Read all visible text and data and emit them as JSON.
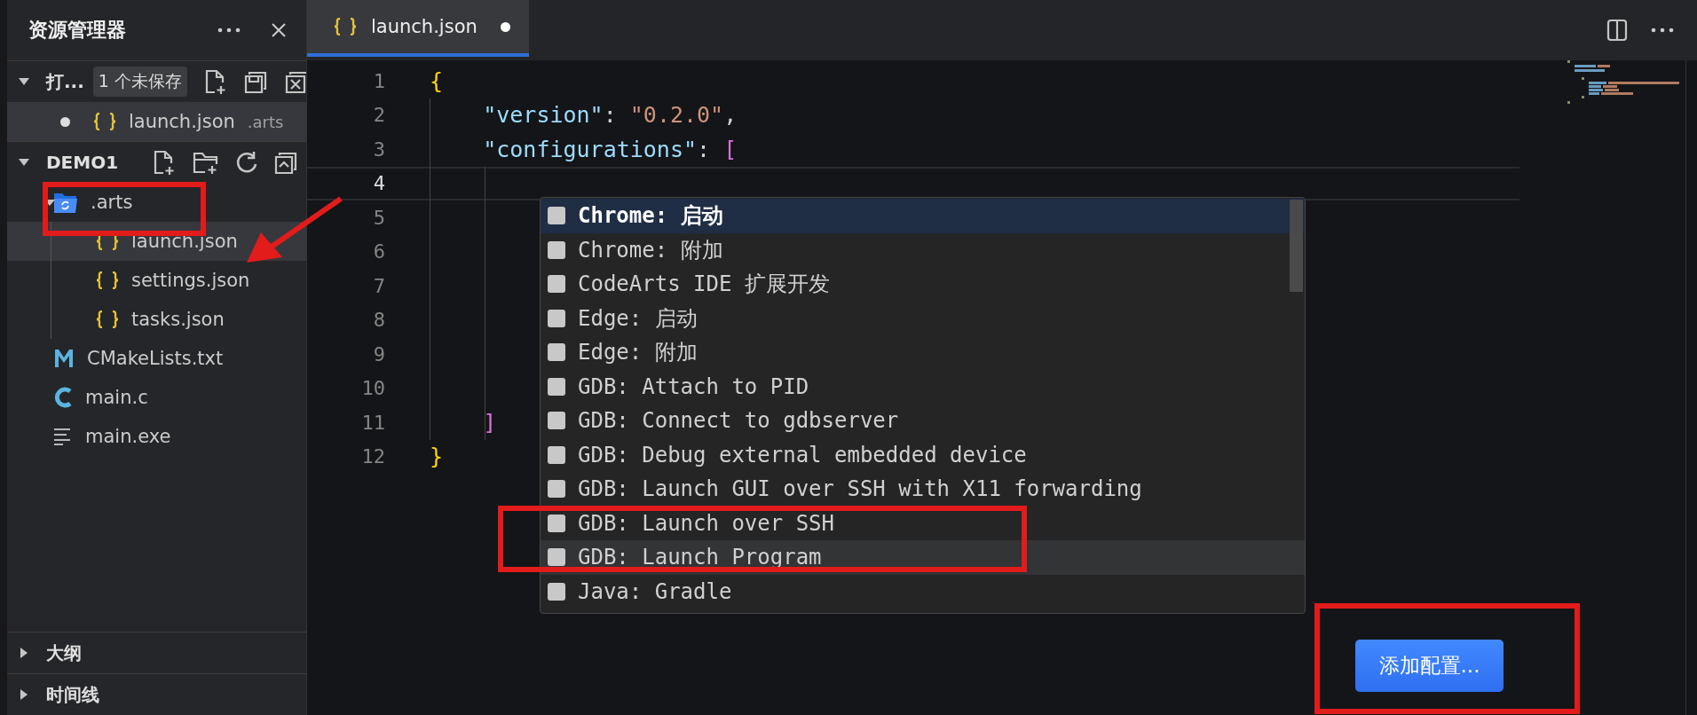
{
  "explorer": {
    "title": "资源管理器",
    "open_editors": {
      "title": "打...",
      "expanded": true,
      "badge": "1 个未保存",
      "items": [
        {
          "name": "launch.json",
          "description": ".arts",
          "dirty": true,
          "kind": "json",
          "selected": true
        }
      ]
    },
    "folder": {
      "title": "DEMO1",
      "expanded": true,
      "items": [
        {
          "name": ".arts",
          "kind": "folder",
          "expanded": true,
          "selected": false,
          "children": [
            {
              "name": "launch.json",
              "kind": "json",
              "selected": true
            },
            {
              "name": "settings.json",
              "kind": "json",
              "selected": false
            },
            {
              "name": "tasks.json",
              "kind": "json",
              "selected": false
            }
          ]
        },
        {
          "name": "CMakeLists.txt",
          "kind": "cmake",
          "selected": false
        },
        {
          "name": "main.c",
          "kind": "c",
          "selected": false
        },
        {
          "name": "main.exe",
          "kind": "text",
          "selected": false
        }
      ]
    },
    "collapsed_sections": [
      {
        "title": "大纲",
        "expanded": false
      },
      {
        "title": "时间线",
        "expanded": false
      }
    ]
  },
  "tabs": [
    {
      "label": "launch.json",
      "dirty": true,
      "selected": true
    }
  ],
  "code": [
    {
      "number": "1",
      "tokens": [
        {
          "kind": "brace",
          "text": "{"
        }
      ]
    },
    {
      "number": "2",
      "tokens": [
        {
          "kind": "key",
          "text": "    \"version\""
        },
        {
          "kind": "punct",
          "text": ": "
        },
        {
          "kind": "string",
          "text": "\"0.2.0\""
        },
        {
          "kind": "punct",
          "text": ","
        }
      ]
    },
    {
      "number": "3",
      "tokens": [
        {
          "kind": "key",
          "text": "    \"configurations\""
        },
        {
          "kind": "punct",
          "text": ": "
        },
        {
          "kind": "match",
          "text": "["
        }
      ]
    },
    {
      "number": "4",
      "current": true
    },
    {
      "number": "5"
    },
    {
      "number": "6"
    },
    {
      "number": "7"
    },
    {
      "number": "8"
    },
    {
      "number": "9"
    },
    {
      "number": "10"
    },
    {
      "number": "11",
      "tokens": [
        {
          "kind": "match",
          "text": "    ]"
        }
      ]
    },
    {
      "number": "12",
      "tokens": [
        {
          "kind": "brace",
          "text": "}"
        }
      ]
    }
  ],
  "suggestions": [
    {
      "label": "Chrome: 启动",
      "selected": true
    },
    {
      "label": "Chrome: 附加",
      "selected": false
    },
    {
      "label": "CodeArts IDE 扩展开发",
      "selected": false
    },
    {
      "label": "Edge: 启动",
      "selected": false
    },
    {
      "label": "Edge: 附加",
      "selected": false
    },
    {
      "label": "GDB: Attach to PID",
      "selected": false
    },
    {
      "label": "GDB: Connect to gdbserver",
      "selected": false
    },
    {
      "label": "GDB: Debug external embedded device",
      "selected": false
    },
    {
      "label": "GDB: Launch GUI over SSH with X11 forwarding",
      "selected": false
    },
    {
      "label": "GDB: Launch over SSH",
      "selected": false
    },
    {
      "label": "GDB: Launch Program",
      "selected": false,
      "hovered": true
    },
    {
      "label": "Java: Gradle",
      "selected": false
    }
  ],
  "add_config_button": "添加配置..."
}
